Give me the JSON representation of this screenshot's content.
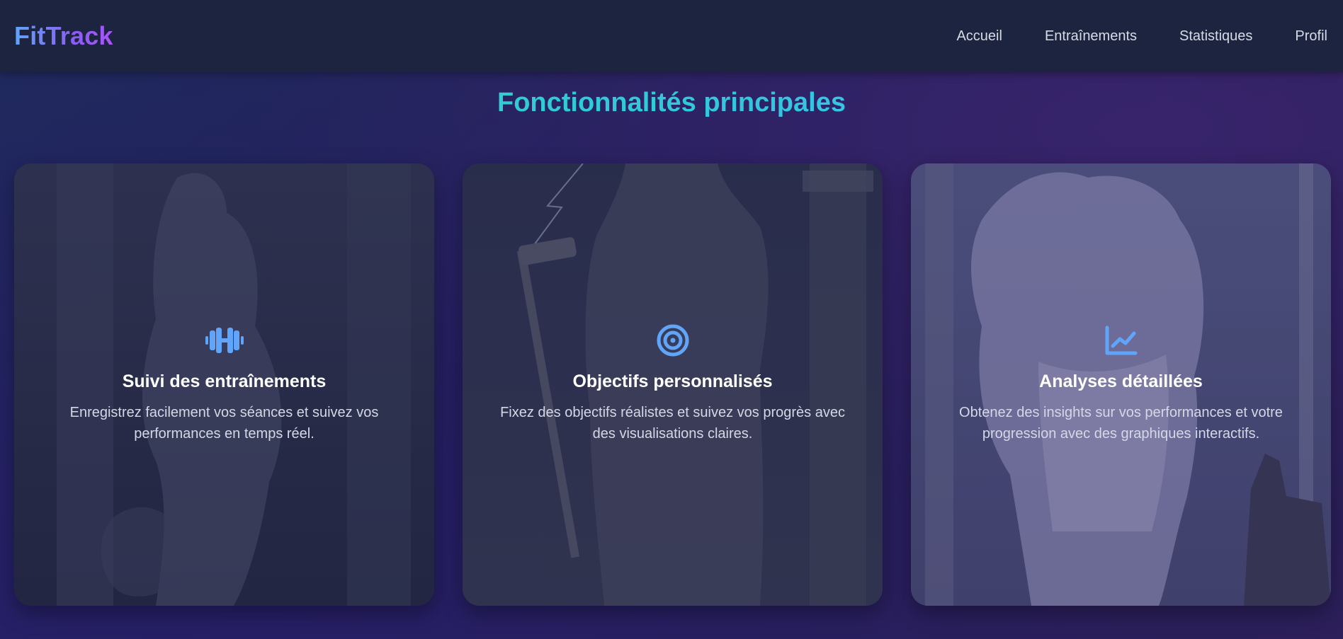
{
  "app": {
    "logo": "FitTrack"
  },
  "nav": {
    "items": [
      {
        "label": "Accueil"
      },
      {
        "label": "Entraînements"
      },
      {
        "label": "Statistiques"
      },
      {
        "label": "Profil"
      }
    ]
  },
  "features": {
    "title": "Fonctionnalités principales",
    "cards": [
      {
        "icon": "dumbbell-icon",
        "title": "Suivi des entraînements",
        "description": "Enregistrez facilement vos séances et suivez vos performances en temps réel."
      },
      {
        "icon": "target-icon",
        "title": "Objectifs personnalisés",
        "description": "Fixez des objectifs réalistes et suivez vos progrès avec des visualisations claires."
      },
      {
        "icon": "chart-line-icon",
        "title": "Analyses détaillées",
        "description": "Obtenez des insights sur vos performances et votre progression avec des graphiques interactifs."
      }
    ]
  },
  "colors": {
    "accent_blue": "#60a5fa",
    "logo_gradient": [
      "#60a5fa",
      "#a855f7"
    ],
    "title_gradient": [
      "#2dd4bf",
      "#38bdf8"
    ],
    "navbar_bg": "#1c2440"
  }
}
